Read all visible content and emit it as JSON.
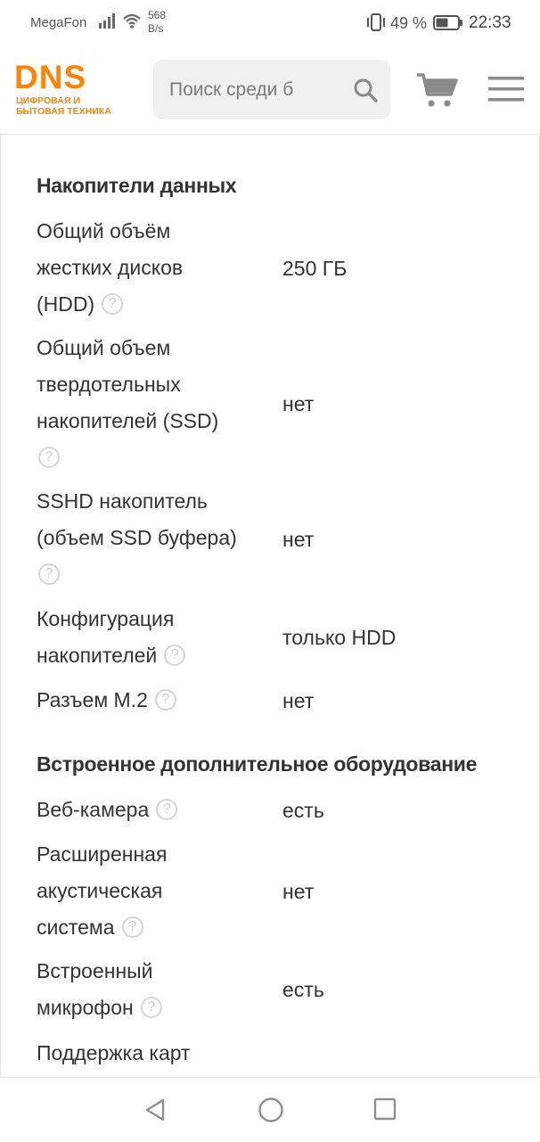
{
  "status_bar": {
    "carrier": "MegaFon",
    "speed_value": "568",
    "speed_unit": "B/s",
    "battery_percent": "49 %",
    "time": "22:33"
  },
  "header": {
    "logo_main": "DNS",
    "logo_sub": "ЦИФРОВАЯ И\nБЫТОВАЯ ТЕХНИКА",
    "search_placeholder": "Поиск среди б",
    "brand_color": "#fc8507",
    "icons": [
      "search-icon",
      "cart-icon",
      "menu-icon"
    ]
  },
  "sections": [
    {
      "title": "Накопители данных",
      "specs": [
        {
          "name": "Общий объём жестких дисков (HDD)",
          "value": "250 ГБ"
        },
        {
          "name": "Общий объем твердотельных накопителей (SSD)",
          "value": "нет"
        },
        {
          "name": "SSHD накопитель (объем SSD буфера)",
          "value": "нет"
        },
        {
          "name": "Конфигурация накопителей",
          "value": "только HDD"
        },
        {
          "name": "Разъем M.2",
          "value": "нет"
        }
      ]
    },
    {
      "title": "Встроенное дополнительное оборудование",
      "specs": [
        {
          "name": "Веб-камера",
          "value": "есть"
        },
        {
          "name": "Расширенная акустическая система",
          "value": "нет"
        },
        {
          "name": "Встроенный микрофон",
          "value": "есть"
        },
        {
          "name": "Поддержка карт",
          "value": ""
        }
      ]
    }
  ],
  "help_icon_glyph": "?"
}
